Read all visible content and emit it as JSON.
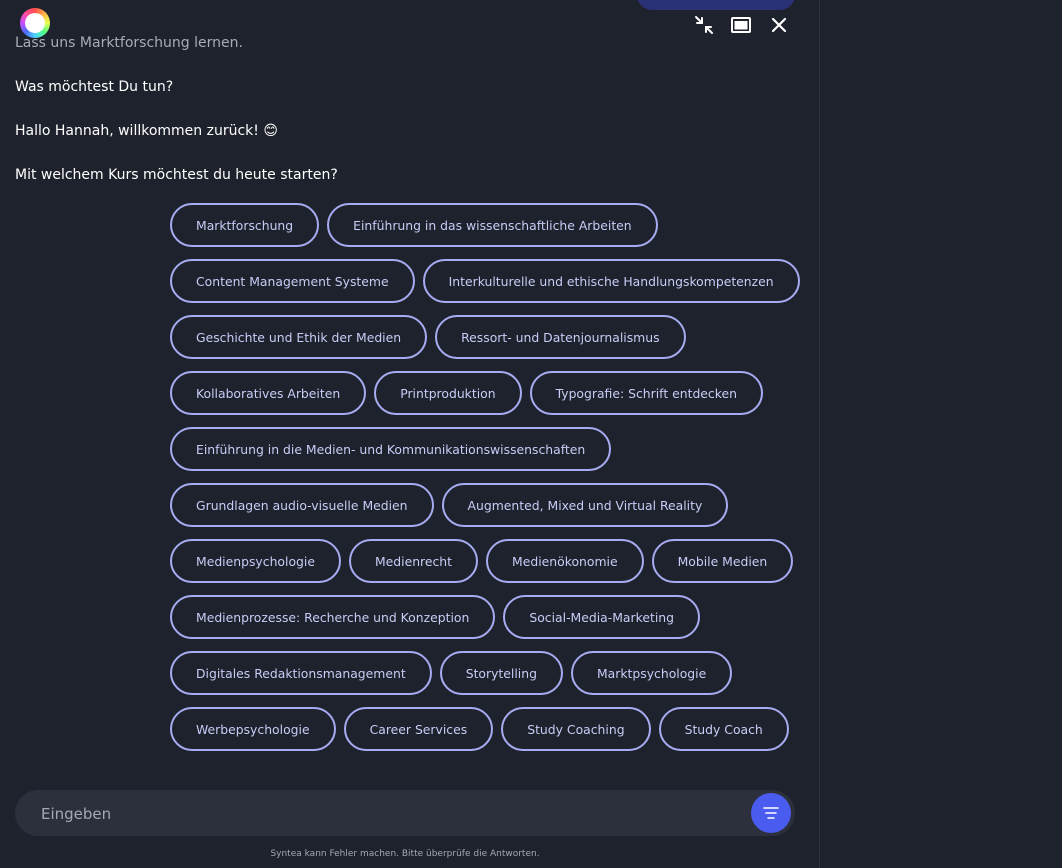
{
  "window": {
    "collapse_icon": "collapse-icon",
    "window_icon": "window-icon",
    "close_icon": "close-icon"
  },
  "messages": {
    "intro": "Lass uns Marktforschung lernen.",
    "question": "Was möchtest Du tun?",
    "greeting": "Hallo Hannah, willkommen zurück! 😊",
    "prompt": "Mit welchem Kurs möchtest du heute starten?"
  },
  "courses": [
    "Marktforschung",
    "Einführung in das wissenschaftliche Arbeiten",
    "Content Management Systeme",
    "Interkulturelle und ethische Handlungskompetenzen",
    "Geschichte und Ethik der Medien",
    "Ressort- und Datenjournalismus",
    "Kollaboratives Arbeiten",
    "Printproduktion",
    "Typografie: Schrift entdecken",
    "Einführung in die Medien- und Kommunikationswissenschaften",
    "Grundlagen audio-visuelle Medien",
    "Augmented, Mixed und Virtual Reality",
    "Medienpsychologie",
    "Medienrecht",
    "Medienökonomie",
    "Mobile Medien",
    "Medienprozesse: Recherche und Konzeption",
    "Social-Media-Marketing",
    "Digitales Redaktionsmanagement",
    "Storytelling",
    "Marktpsychologie",
    "Werbepsychologie",
    "Career Services",
    "Study Coaching",
    "Study Coach"
  ],
  "input": {
    "placeholder": "Eingeben",
    "send_icon": "menu-lines-icon"
  },
  "disclaimer": "Syntea kann Fehler machen. Bitte überprüfe die Antworten.",
  "colors": {
    "background": "#1e222c",
    "chip_border": "#a7acf2",
    "send_button": "#4a5bf0",
    "input_bg": "#2b303c"
  }
}
